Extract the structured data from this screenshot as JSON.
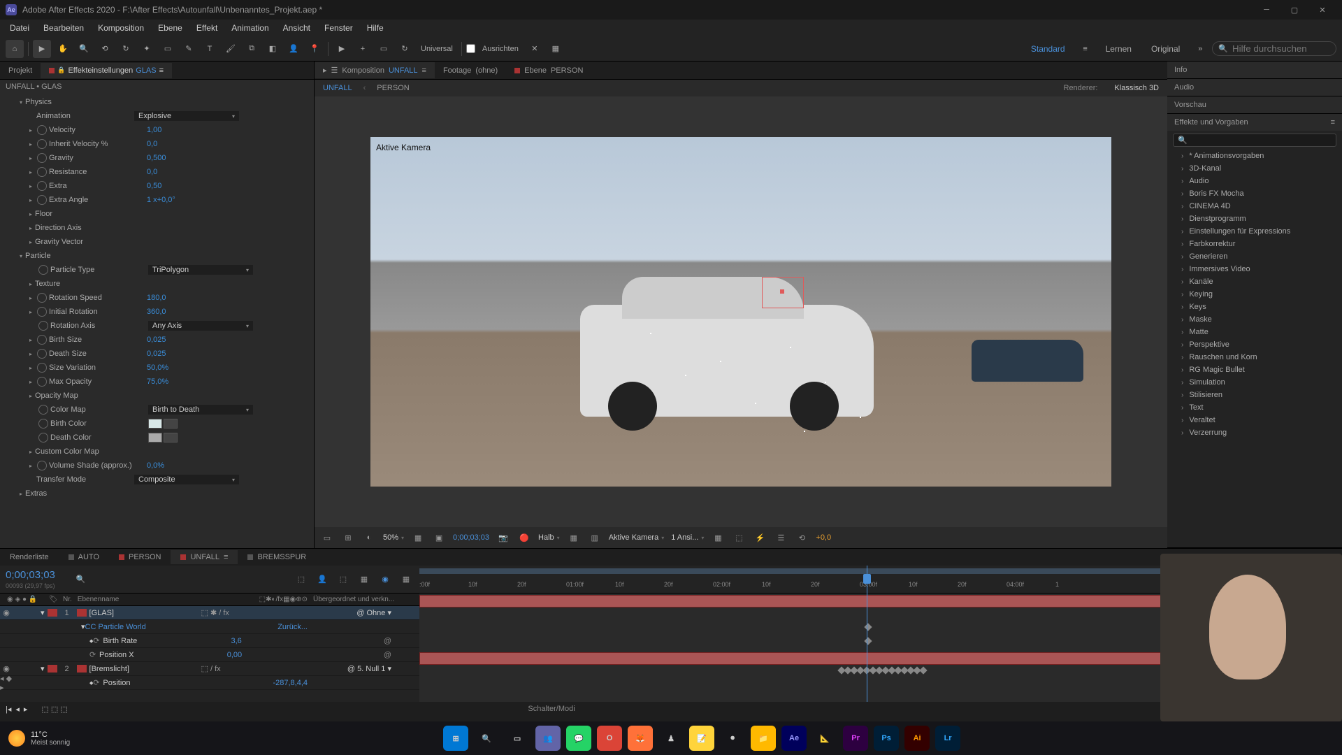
{
  "titlebar": {
    "app_abbrev": "Ae",
    "title": "Adobe After Effects 2020 - F:\\After Effects\\Autounfall\\Unbenanntes_Projekt.aep *"
  },
  "menu": [
    "Datei",
    "Bearbeiten",
    "Komposition",
    "Ebene",
    "Effekt",
    "Animation",
    "Ansicht",
    "Fenster",
    "Hilfe"
  ],
  "toolbar": {
    "universal": "Universal",
    "ausrichten": "Ausrichten",
    "workspaces": [
      "Standard",
      "Lernen",
      "Original"
    ],
    "search_placeholder": "Hilfe durchsuchen"
  },
  "left_panel": {
    "tab_project": "Projekt",
    "tab_effects": "Effekteinstellungen",
    "tab_effects_target": "GLAS",
    "path": "UNFALL • GLAS",
    "groups": {
      "physics": "Physics",
      "particle": "Particle",
      "opacity_map": "Opacity Map",
      "extras": "Extras"
    },
    "props": {
      "animation": {
        "label": "Animation",
        "value": "Explosive"
      },
      "velocity": {
        "label": "Velocity",
        "value": "1,00"
      },
      "inherit_velocity": {
        "label": "Inherit Velocity %",
        "value": "0,0"
      },
      "gravity": {
        "label": "Gravity",
        "value": "0,500"
      },
      "resistance": {
        "label": "Resistance",
        "value": "0,0"
      },
      "extra": {
        "label": "Extra",
        "value": "0,50"
      },
      "extra_angle": {
        "label": "Extra Angle",
        "value": "1 x+0,0°"
      },
      "floor": {
        "label": "Floor"
      },
      "direction_axis": {
        "label": "Direction Axis"
      },
      "gravity_vector": {
        "label": "Gravity Vector"
      },
      "particle_type": {
        "label": "Particle Type",
        "value": "TriPolygon"
      },
      "texture": {
        "label": "Texture"
      },
      "rotation_speed": {
        "label": "Rotation Speed",
        "value": "180,0"
      },
      "initial_rotation": {
        "label": "Initial Rotation",
        "value": "360,0"
      },
      "rotation_axis": {
        "label": "Rotation Axis",
        "value": "Any Axis"
      },
      "birth_size": {
        "label": "Birth Size",
        "value": "0,025"
      },
      "death_size": {
        "label": "Death Size",
        "value": "0,025"
      },
      "size_variation": {
        "label": "Size Variation",
        "value": "50,0%"
      },
      "max_opacity": {
        "label": "Max Opacity",
        "value": "75,0%"
      },
      "color_map": {
        "label": "Color Map",
        "value": "Birth to Death"
      },
      "birth_color": {
        "label": "Birth Color"
      },
      "death_color": {
        "label": "Death Color"
      },
      "custom_color_map": {
        "label": "Custom Color Map"
      },
      "volume_shade": {
        "label": "Volume Shade (approx.)",
        "value": "0,0%"
      },
      "transfer_mode": {
        "label": "Transfer Mode",
        "value": "Composite"
      }
    }
  },
  "comp": {
    "tab_comp": "Komposition",
    "tab_comp_name": "UNFALL",
    "tab_footage": "Footage",
    "tab_footage_val": "(ohne)",
    "tab_layer": "Ebene",
    "tab_layer_val": "PERSON",
    "crumbs": [
      "UNFALL",
      "PERSON"
    ],
    "renderer_label": "Renderer:",
    "renderer_value": "Klassisch 3D",
    "active_camera": "Aktive Kamera"
  },
  "viewer_footer": {
    "zoom": "50%",
    "time": "0;00;03;03",
    "res": "Halb",
    "camera": "Aktive Kamera",
    "views": "1 Ansi...",
    "exposure": "+0,0"
  },
  "right_panel": {
    "sec_info": "Info",
    "sec_audio": "Audio",
    "sec_preview": "Vorschau",
    "sec_effects": "Effekte und Vorgaben",
    "presets": [
      "* Animationsvorgaben",
      "3D-Kanal",
      "Audio",
      "Boris FX Mocha",
      "CINEMA 4D",
      "Dienstprogramm",
      "Einstellungen für Expressions",
      "Farbkorrektur",
      "Generieren",
      "Immersives Video",
      "Kanäle",
      "Keying",
      "Keys",
      "Maske",
      "Matte",
      "Perspektive",
      "Rauschen und Korn",
      "RG Magic Bullet",
      "Simulation",
      "Stilisieren",
      "Text",
      "Veraltet",
      "Verzerrung"
    ]
  },
  "timeline": {
    "tab_render": "Renderliste",
    "tabs": [
      "AUTO",
      "PERSON",
      "UNFALL",
      "BREMSSPUR"
    ],
    "time": "0;00;03;03",
    "fps": "00093 (29,97 fps)",
    "cols": {
      "nr": "Nr.",
      "name": "Ebenenname",
      "parent": "Übergeordnet und verkn..."
    },
    "ruler": [
      ":00f",
      "10f",
      "20f",
      "01:00f",
      "10f",
      "20f",
      "02:00f",
      "10f",
      "20f",
      "03:00f",
      "10f",
      "20f",
      "04:00f",
      "1"
    ],
    "layers": {
      "l1": {
        "num": "1",
        "name": "[GLAS]",
        "parent": "Ohne"
      },
      "l1_effect": "CC Particle World",
      "l1_effect_val": "Zurück...",
      "l1_birth": {
        "label": "Birth Rate",
        "value": "3,6"
      },
      "l1_posx": {
        "label": "Position X",
        "value": "0,00"
      },
      "l2": {
        "num": "2",
        "name": "[Bremslicht]",
        "parent": "5. Null 1"
      },
      "l2_pos": {
        "label": "Position",
        "value": "-287,8,4,4"
      }
    },
    "mode_label": "Schalter/Modi"
  },
  "taskbar": {
    "temp": "11°C",
    "cond": "Meist sonnig"
  }
}
